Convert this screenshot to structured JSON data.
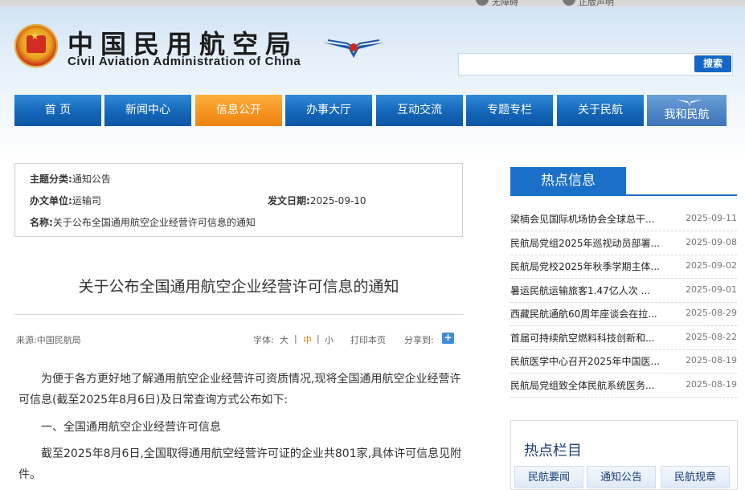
{
  "top_links": [
    "无障碍",
    "正版声明"
  ],
  "header": {
    "title_cn": "中国民用航空局",
    "title_en": "Civil Aviation Administration of China",
    "search_button": "搜索",
    "search_value": ""
  },
  "nav": [
    {
      "label": "首 页"
    },
    {
      "label": "新闻中心"
    },
    {
      "label": "信息公开"
    },
    {
      "label": "办事大厅"
    },
    {
      "label": "互动交流"
    },
    {
      "label": "专题专栏"
    },
    {
      "label": "关于民航"
    },
    {
      "label": "我和民航"
    }
  ],
  "meta": {
    "category_label": "主题分类:",
    "category_value": "通知公告",
    "unit_label": "办文单位:",
    "unit_value": "运输司",
    "date_label": "发文日期:",
    "date_value": "2025-09-10",
    "name_label": "名称:",
    "name_value": "关于公布全国通用航空企业经营许可信息的通知"
  },
  "article": {
    "title": "关于公布全国通用航空企业经营许可信息的通知",
    "source": "来源:中国民航局",
    "font_label": "字体:",
    "font_large": "大",
    "font_medium": "中",
    "font_small": "小",
    "sep": "|",
    "print": "打印本页",
    "share": "分享到:",
    "paragraphs": [
      "为便于各方更好地了解通用航空企业经营许可资质情况,现将全国通用航空企业经营许可信息(截至2025年8月6日)及日常查询方式公布如下:",
      "一、全国通用航空企业经营许可信息",
      "截至2025年8月6日,全国取得通用航空经营许可证的企业共801家,具体许可信息见附件。"
    ]
  },
  "sidebar": {
    "hot_title": "热点信息",
    "news": [
      {
        "title": "梁楠会见国际机场协会全球总干...",
        "date": "2025-09-11"
      },
      {
        "title": "民航局党组2025年巡视动员部署...",
        "date": "2025-09-08"
      },
      {
        "title": "民航局党校2025年秋季学期主体...",
        "date": "2025-09-02"
      },
      {
        "title": "暑运民航运输旅客1.47亿人次 ...",
        "date": "2025-09-01"
      },
      {
        "title": "西藏民航通航60周年座谈会在拉...",
        "date": "2025-08-29"
      },
      {
        "title": "首届可持续航空燃料科技创新和...",
        "date": "2025-08-22"
      },
      {
        "title": "民航医学中心召开2025年中国医...",
        "date": "2025-08-19"
      },
      {
        "title": "民航局党组致全体民航系统医务...",
        "date": "2025-08-19"
      }
    ],
    "column_title": "热点栏目",
    "columns": [
      {
        "label": "民航要闻"
      },
      {
        "label": "通知公告"
      },
      {
        "label": "民航规章"
      }
    ]
  },
  "colors": {
    "nav_blue": "#1466b8",
    "nav_active": "#f5921e",
    "hot_blue": "#1a70c8"
  }
}
